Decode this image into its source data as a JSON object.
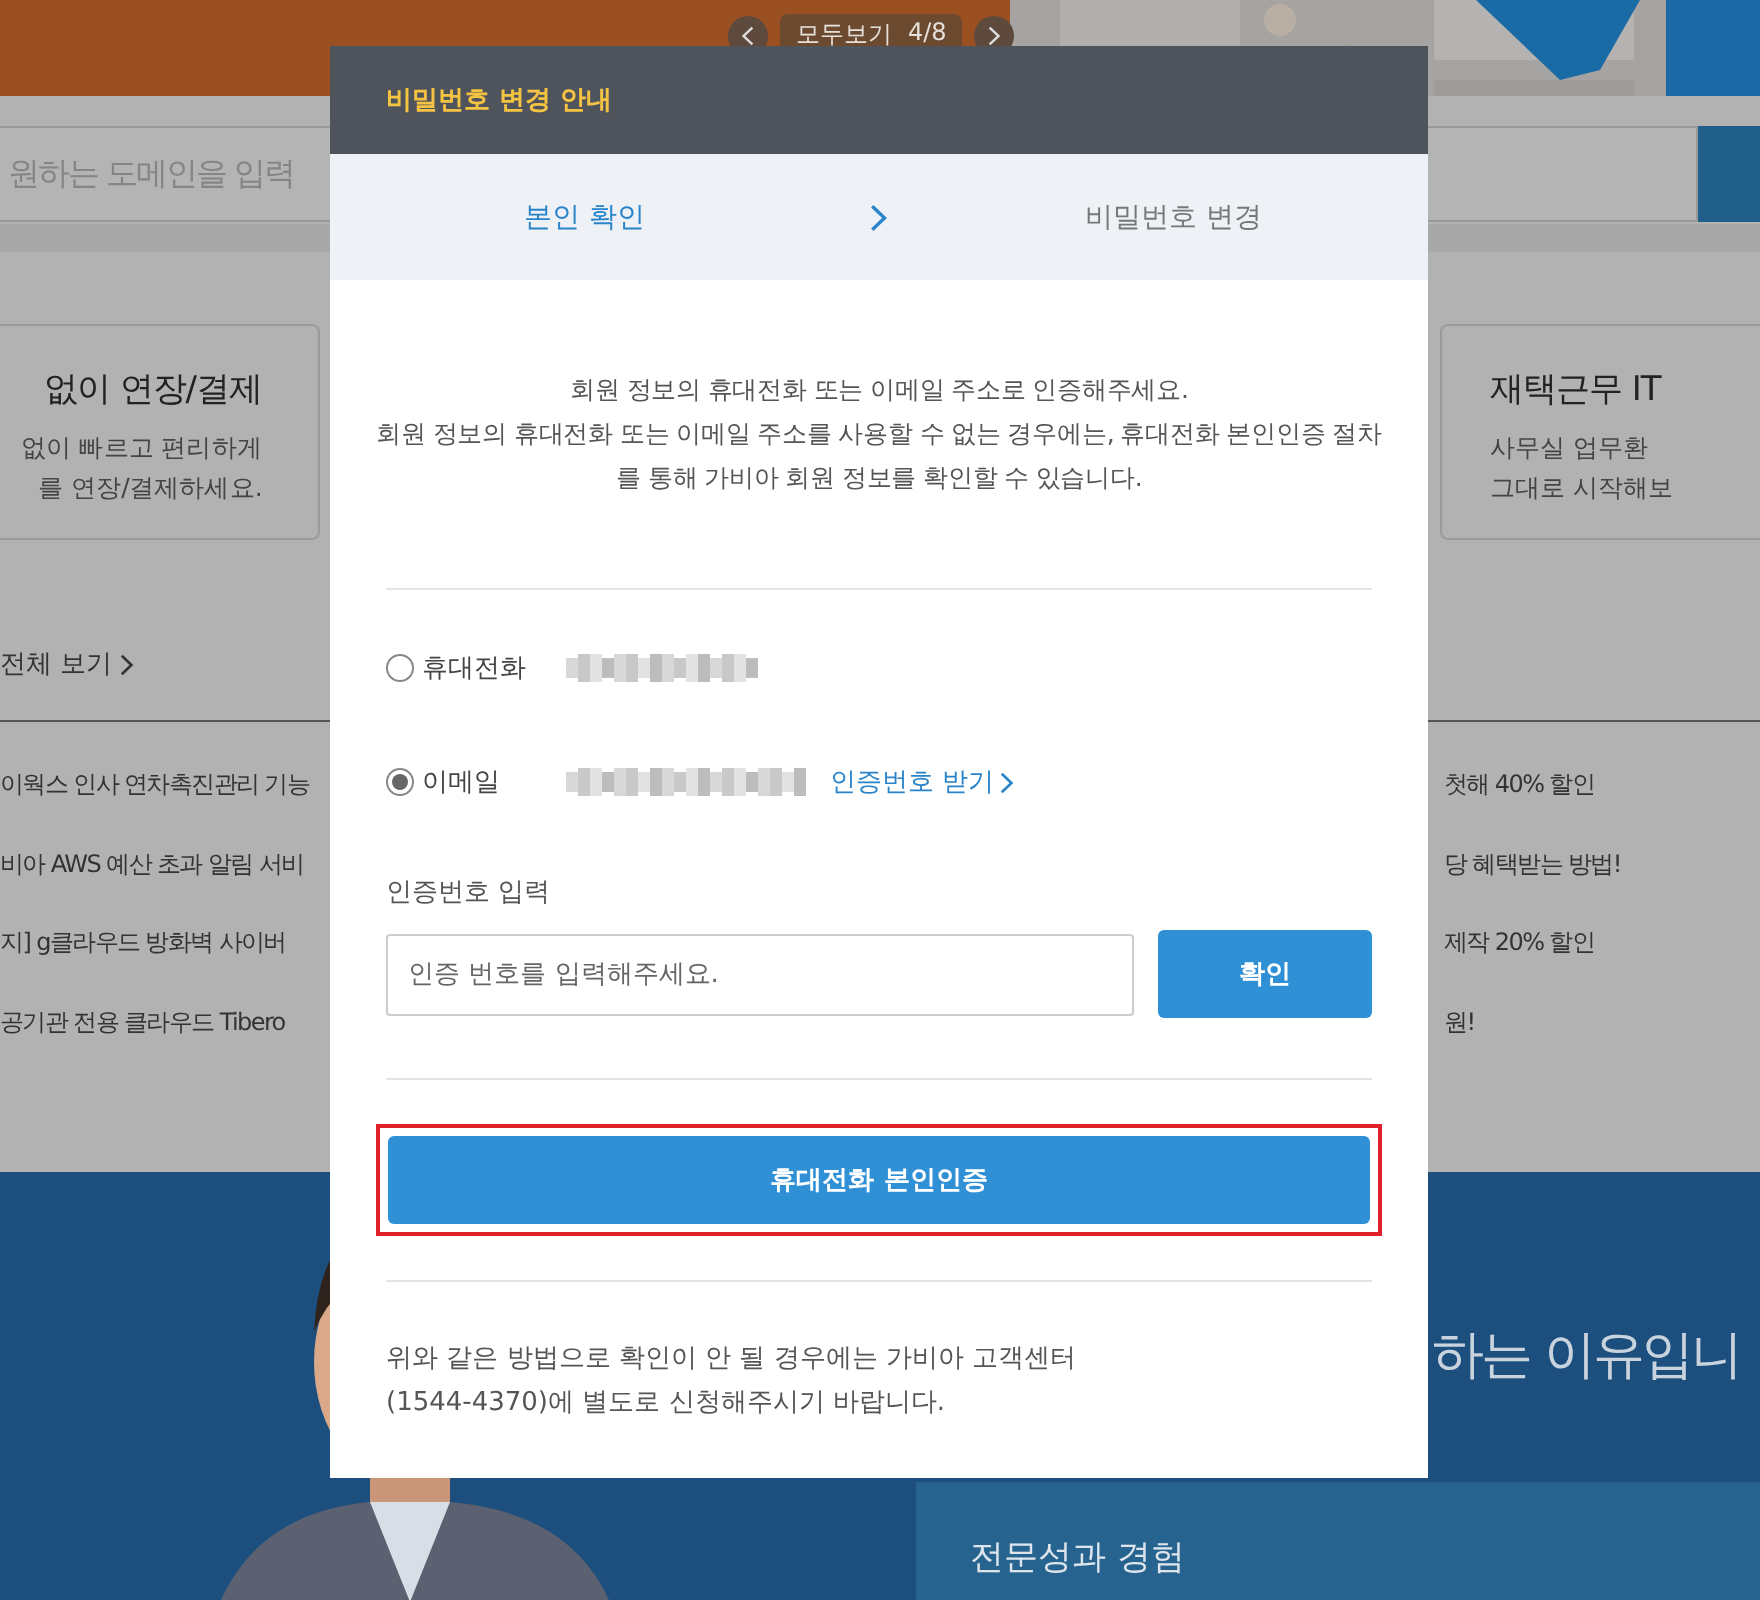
{
  "background": {
    "pager": {
      "label": "모두보기",
      "count": "4/8"
    },
    "search": {
      "placeholder": "원하는 도메인을 입력"
    },
    "cards": [
      {
        "title": "없이 연장/결제",
        "lines": [
          "없이 빠르고 편리하게",
          "를 연장/결제하세요."
        ]
      },
      {
        "title": "재택근무 IT",
        "lines": [
          "사무실 업무환",
          "그대로 시작해보"
        ]
      }
    ],
    "view_all": "전체 보기",
    "news_left": [
      "이웍스 인사 연차촉진관리 기능",
      "비아 AWS 예산 초과 알림 서비",
      "지] g클라우드 방화벽 사이버",
      "공기관 전용 클라우드 Tibero"
    ],
    "news_right": [
      "첫해 40% 할인",
      "당 혜택받는 방법!",
      "제작 20% 할인",
      "원!"
    ],
    "section_heading": "하는 이유입니",
    "feature_title": "전문성과 경험"
  },
  "modal": {
    "title": "비밀번호 변경 안내",
    "steps": [
      {
        "label": "본인 확인",
        "selected": true
      },
      {
        "label": "비밀번호 변경",
        "selected": false
      }
    ],
    "description": [
      "회원 정보의 휴대전화 또는 이메일 주소로 인증해주세요.",
      "회원 정보의 휴대전화 또는 이메일 주소를 사용할 수 없는 경우에는, 휴대전화 본인인증 절차",
      "를 통해 가비아 회원 정보를 확인할 수 있습니다."
    ],
    "methods": [
      {
        "label": "휴대전화",
        "selected": false
      },
      {
        "label": "이메일",
        "selected": true,
        "action": "인증번호 받기"
      }
    ],
    "code": {
      "label": "인증번호 입력",
      "placeholder": "인증 번호를 입력해주세요.",
      "button": "확인"
    },
    "phone_button": {
      "label": "휴대전화 본인인증",
      "highlighted": true
    },
    "footer": [
      "위와 같은 방법으로 확인이 안 될 경우에는 가비아 고객센터",
      "(1544-4370)에 별도로 신청해주시기 바랍니다."
    ]
  }
}
